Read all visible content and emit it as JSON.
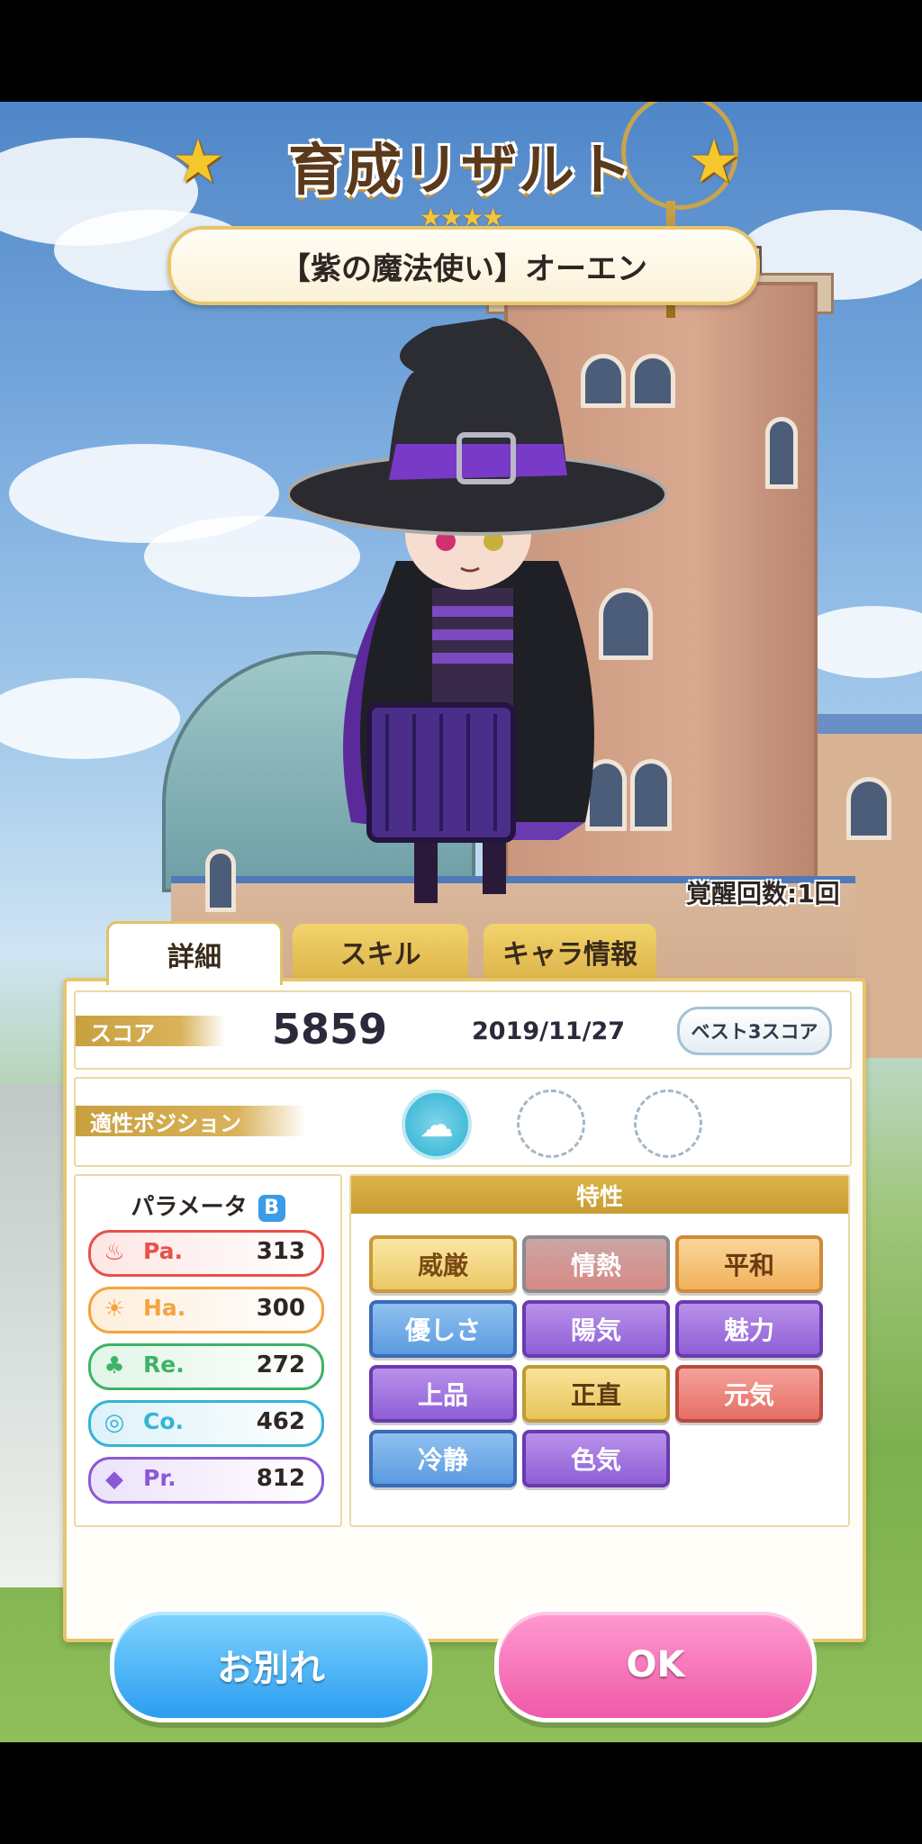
{
  "header": {
    "title": "育成リザルト",
    "rarity_stars": "★★★★",
    "character_name": "【紫の魔法使い】オーエン"
  },
  "awakening": "覚醒回数:1回",
  "tabs": [
    {
      "label": "詳細",
      "active": true
    },
    {
      "label": "スキル",
      "active": false
    },
    {
      "label": "キャラ情報",
      "active": false
    }
  ],
  "score": {
    "label": "スコア",
    "value": "5859",
    "date": "2019/11/27",
    "best_button": "ベスト3スコア"
  },
  "position": {
    "label": "適性ポジション"
  },
  "parameters": {
    "title": "パラメータ",
    "rank": "B",
    "stats": [
      {
        "name": "Pa.",
        "value": "313",
        "color": "#e8514a",
        "icon": "flame-icon"
      },
      {
        "name": "Ha.",
        "value": "300",
        "color": "#f4a340",
        "icon": "sun-icon"
      },
      {
        "name": "Re.",
        "value": "272",
        "color": "#3fb267",
        "icon": "clover-icon"
      },
      {
        "name": "Co.",
        "value": "462",
        "color": "#35b3d8",
        "icon": "swirl-icon"
      },
      {
        "name": "Pr.",
        "value": "812",
        "color": "#8a5ad6",
        "icon": "gem-icon"
      }
    ]
  },
  "traits": {
    "title": "特性",
    "items": [
      "威厳",
      "情熱",
      "平和",
      "優しさ",
      "陽気",
      "魅力",
      "上品",
      "正直",
      "元気",
      "冷静",
      "色気"
    ]
  },
  "buttons": {
    "farewell": "お別れ",
    "ok": "OK"
  }
}
